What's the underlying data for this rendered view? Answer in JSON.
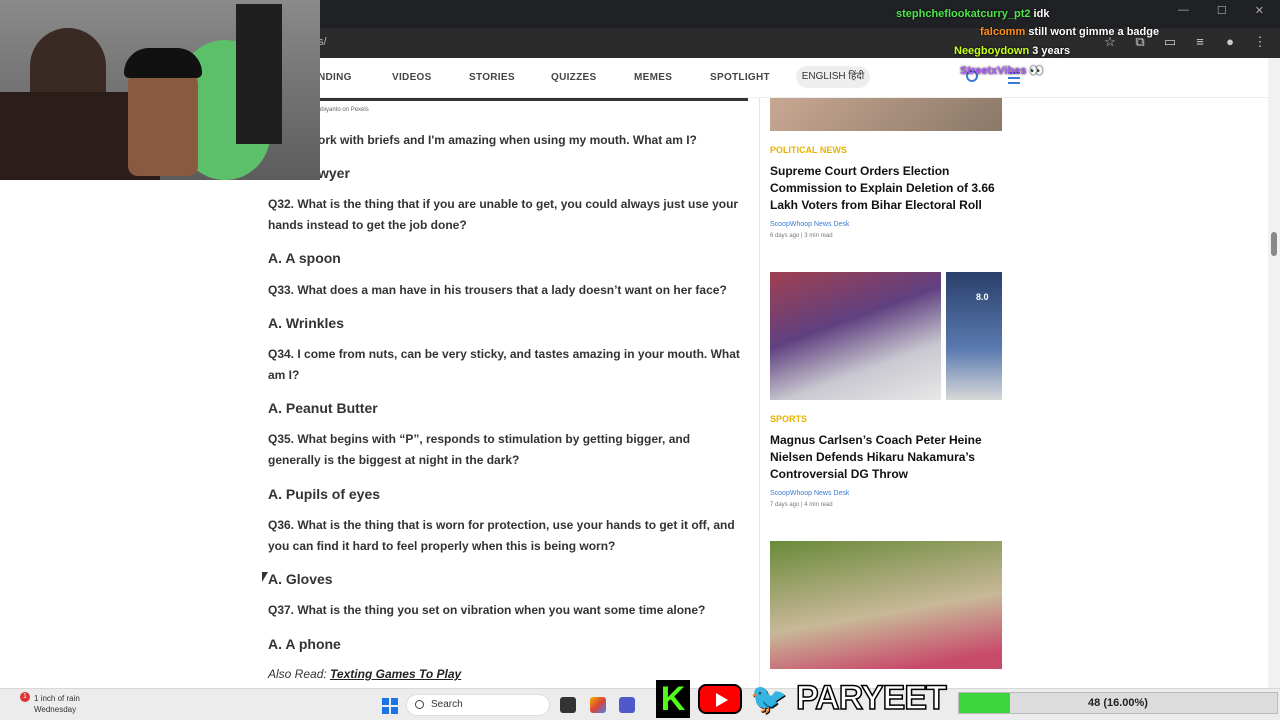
{
  "browser": {
    "url_fragment": "s/"
  },
  "nav": {
    "items": [
      "NDING",
      "VIDEOS",
      "STORIES",
      "QUIZZES",
      "MEMES",
      "SPOTLIGHT"
    ],
    "lang": "ENGLISH  हिंदी"
  },
  "article": {
    "image_credit": "obiyanto on Pexels",
    "q_partial": "ork with briefs and I'm amazing when using my mouth. What am I?",
    "a_partial": "wyer",
    "qa": [
      {
        "q": "Q32. What is the thing that if you are unable to get, you could always just use your hands instead to get the job done?",
        "a": "A. A spoon"
      },
      {
        "q": "Q33. What does a man have in his trousers that a lady doesn’t want on her face?",
        "a": "A. Wrinkles"
      },
      {
        "q": "Q34. I come from nuts, can be very sticky, and tastes amazing in your mouth. What am I?",
        "a": "A. Peanut Butter"
      },
      {
        "q": "Q35. What begins with “P”, responds to stimulation by getting bigger, and generally is the biggest at night in the dark?",
        "a": "A. Pupils of eyes"
      },
      {
        "q": "Q36. What is the thing that is worn for protection, use your hands to get it off, and you can find it hard to feel properly when this is being worn?",
        "a": "A. Gloves"
      },
      {
        "q": "Q37. What is the thing you set on vibration when you want some time alone?",
        "a": "A. A phone"
      }
    ],
    "also_read_label": "Also Read:",
    "also_read_link": "Texting Games To Play"
  },
  "sidebar": {
    "cards": [
      {
        "category": "POLITICAL NEWS",
        "headline": "Supreme Court Orders Election Commission to Explain Deletion of 3.66 Lakh Voters from Bihar Electoral Roll",
        "author": "ScoopWhoop News Desk",
        "meta": "6 days ago | 3 min read"
      },
      {
        "category": "SPORTS",
        "headline": "Magnus Carlsen’s Coach Peter Heine Nielsen Defends Hikaru Nakamura’s Controversial DG Throw",
        "author": "ScoopWhoop News Desk",
        "meta": "7 days ago | 4 min read"
      }
    ],
    "score_badge": "8.0"
  },
  "chat": [
    {
      "user": "stephcheflookatcurry_pt2",
      "msg": "idk",
      "color": "#4ee44e"
    },
    {
      "user": "falcomm",
      "msg": "still wont gimme a badge",
      "color": "#ff8c1a"
    },
    {
      "user": "Neegboydown",
      "msg": "3 years",
      "color": "#c4ff1a"
    },
    {
      "user": "StreetxVibes",
      "msg": "👀",
      "color": "#b05cff"
    }
  ],
  "taskbar": {
    "weather_badge": "1",
    "weather_line1": "1 inch of rain",
    "weather_line2": "Wednesday",
    "search_label": "Search"
  },
  "overlay": {
    "brand_k": "K",
    "brand_name": "PARYEET",
    "goal_text": "48 (16.00%)",
    "goal_fraction": 0.16
  }
}
